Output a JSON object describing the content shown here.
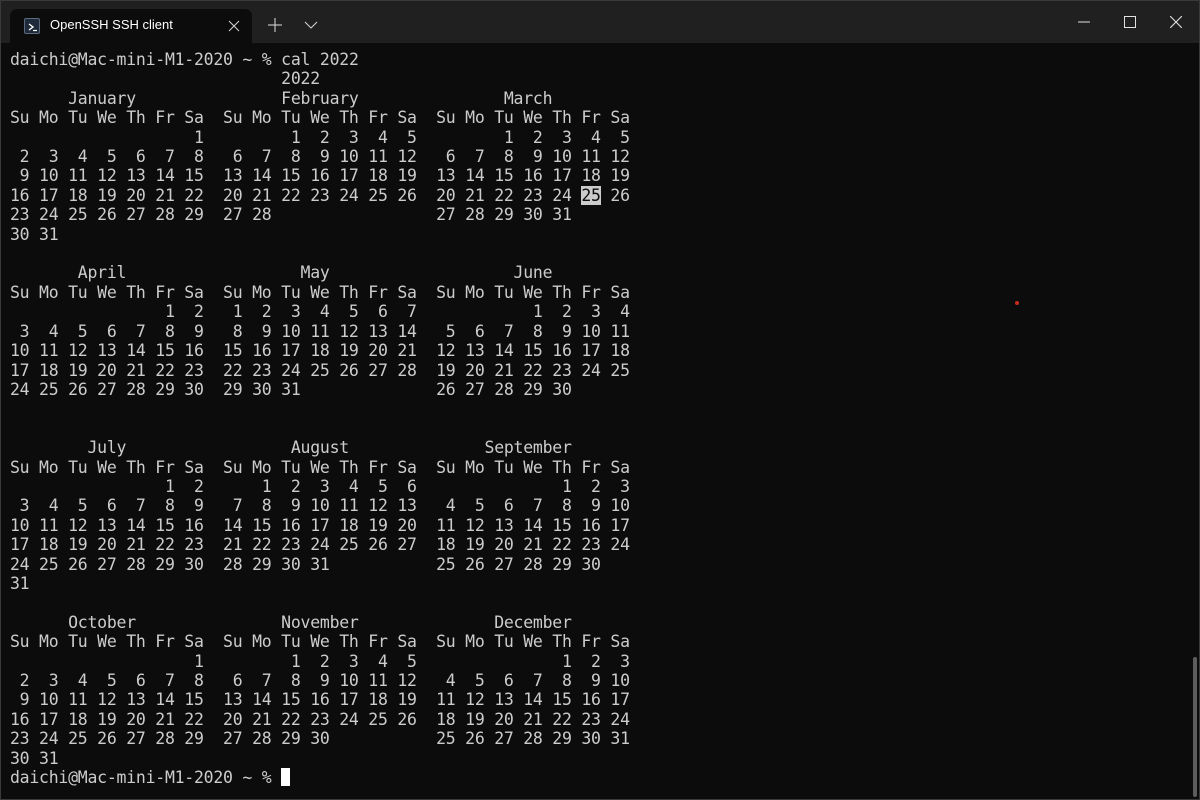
{
  "tab": {
    "title": "OpenSSH SSH client",
    "icon": "powershell-icon"
  },
  "window_controls": [
    "minimize",
    "maximize",
    "close"
  ],
  "terminal": {
    "prompt": "daichi@Mac-mini-M1-2020 ~ % ",
    "command": "cal 2022",
    "highlighted_day": "25",
    "lines": [
      "                            2022",
      "      January               February               March",
      "Su Mo Tu We Th Fr Sa  Su Mo Tu We Th Fr Sa  Su Mo Tu We Th Fr Sa",
      "                   1         1  2  3  4  5         1  2  3  4  5",
      " 2  3  4  5  6  7  8   6  7  8  9 10 11 12   6  7  8  9 10 11 12",
      " 9 10 11 12 13 14 15  13 14 15 16 17 18 19  13 14 15 16 17 18 19",
      "16 17 18 19 20 21 22  20 21 22 23 24 25 26  20 21 22 23 24 ",
      "23 24 25 26 27 28 29  27 28                 27 28 29 30 31",
      "30 31",
      "",
      "       April                  May                   June",
      "Su Mo Tu We Th Fr Sa  Su Mo Tu We Th Fr Sa  Su Mo Tu We Th Fr Sa",
      "                1  2   1  2  3  4  5  6  7            1  2  3  4",
      " 3  4  5  6  7  8  9   8  9 10 11 12 13 14   5  6  7  8  9 10 11",
      "10 11 12 13 14 15 16  15 16 17 18 19 20 21  12 13 14 15 16 17 18",
      "17 18 19 20 21 22 23  22 23 24 25 26 27 28  19 20 21 22 23 24 25",
      "24 25 26 27 28 29 30  29 30 31              26 27 28 29 30",
      "",
      "",
      "        July                 August              September",
      "Su Mo Tu We Th Fr Sa  Su Mo Tu We Th Fr Sa  Su Mo Tu We Th Fr Sa",
      "                1  2      1  2  3  4  5  6               1  2  3",
      " 3  4  5  6  7  8  9   7  8  9 10 11 12 13   4  5  6  7  8  9 10",
      "10 11 12 13 14 15 16  14 15 16 17 18 19 20  11 12 13 14 15 16 17",
      "17 18 19 20 21 22 23  21 22 23 24 25 26 27  18 19 20 21 22 23 24",
      "24 25 26 27 28 29 30  28 29 30 31           25 26 27 28 29 30",
      "31",
      "",
      "      October               November              December",
      "Su Mo Tu We Th Fr Sa  Su Mo Tu We Th Fr Sa  Su Mo Tu We Th Fr Sa",
      "                   1         1  2  3  4  5               1  2  3",
      " 2  3  4  5  6  7  8   6  7  8  9 10 11 12   4  5  6  7  8  9 10",
      " 9 10 11 12 13 14 15  13 14 15 16 17 18 19  11 12 13 14 15 16 17",
      "16 17 18 19 20 21 22  20 21 22 23 24 25 26  18 19 20 21 22 23 24",
      "23 24 25 26 27 28 29  27 28 29 30           25 26 27 28 29 30 31",
      "30 31"
    ],
    "line_after_highlight": " 26"
  }
}
